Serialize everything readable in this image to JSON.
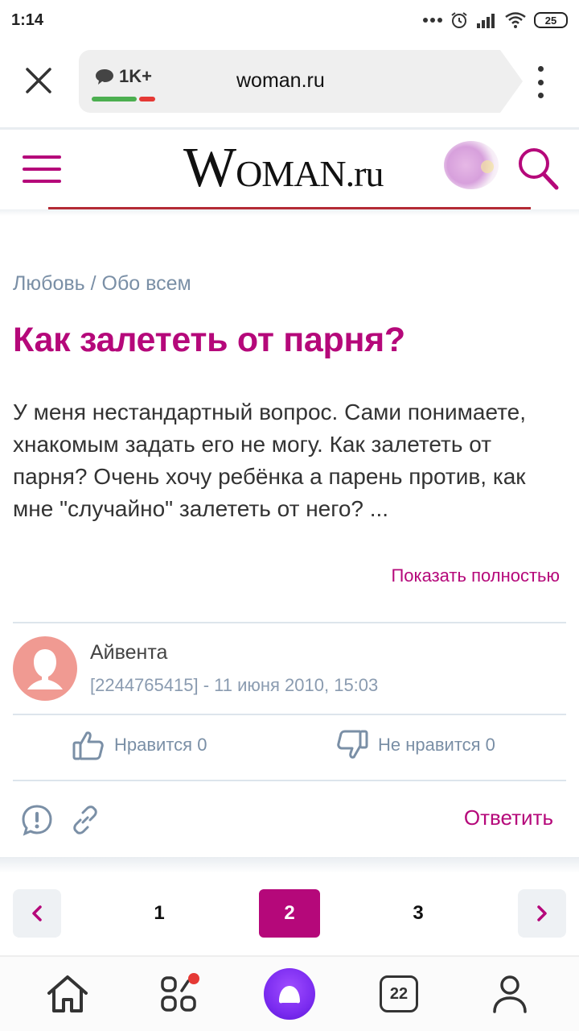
{
  "status": {
    "time": "1:14",
    "battery": "25"
  },
  "browser": {
    "comments_badge": "1K+",
    "domain": "woman.ru"
  },
  "site": {
    "logo_big": "W",
    "logo_rest": "OMAN.ru"
  },
  "article": {
    "breadcrumb": "Любовь / Обо всем",
    "title": "Как залететь от парня?",
    "body": "У меня нестандартный вопрос. Сами понимаете, хнакомым задать его не могу. Как залететь от парня? Очень хочу ребёнка а парень против, как мне \"случайно\" залететь от него? ...",
    "show_more": "Показать полностью"
  },
  "post": {
    "author": "Айвента",
    "meta": "[2244765415] - 11 июня 2010, 15:03",
    "likes": "Нравится 0",
    "dislikes": "Не нравится 0",
    "reply": "Ответить"
  },
  "pagination": {
    "pages": [
      "1",
      "2",
      "3"
    ],
    "active": "2"
  },
  "bottom_nav": {
    "tabs_count": "22"
  },
  "colors": {
    "accent": "#b5087a",
    "muted": "#7a8fa6",
    "logo_line": "#b42b35"
  }
}
